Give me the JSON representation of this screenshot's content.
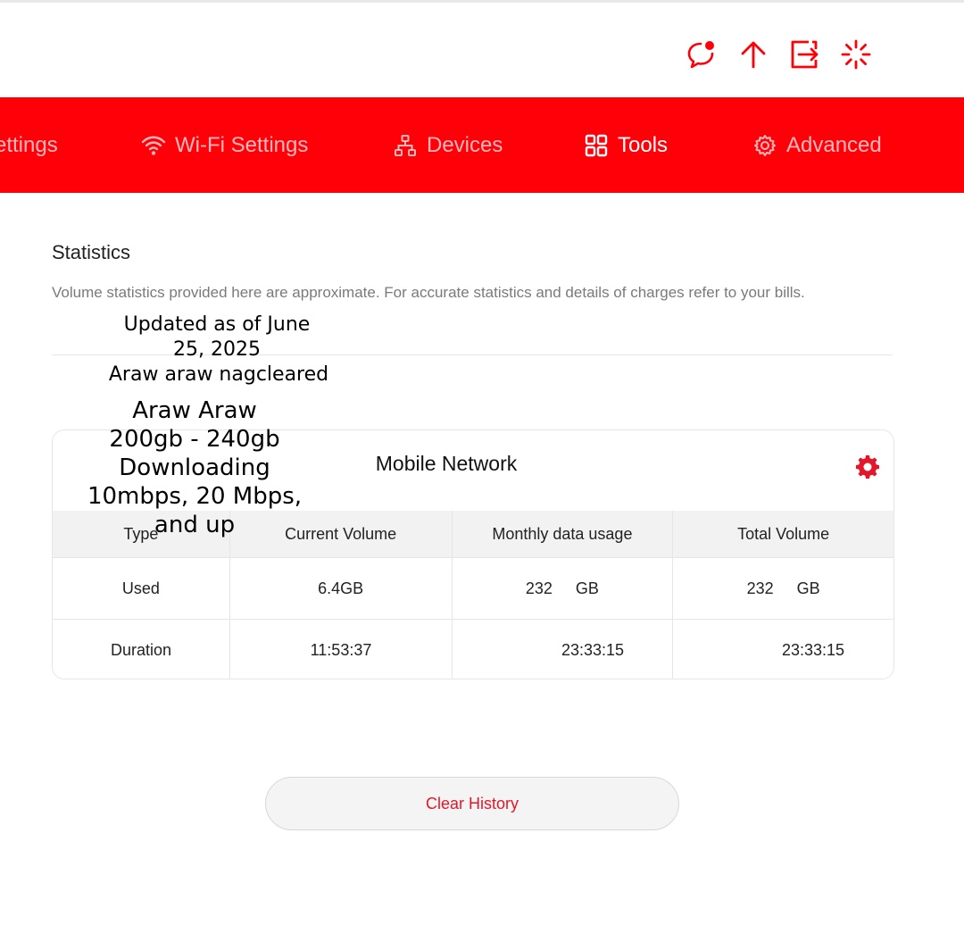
{
  "header": {
    "icons": [
      "message-alert-icon",
      "upload-icon",
      "logout-icon",
      "loading-spinner-icon"
    ],
    "accent_color": "#ff0009"
  },
  "nav": {
    "items": [
      {
        "label": "ettings",
        "icon": ""
      },
      {
        "label": "Wi-Fi Settings",
        "icon": "wifi-icon"
      },
      {
        "label": "Devices",
        "icon": "network-icon"
      },
      {
        "label": "Tools",
        "icon": "grid-icon",
        "active": true
      },
      {
        "label": "Advanced",
        "icon": "gear-icon"
      }
    ]
  },
  "page": {
    "title": "Statistics",
    "description": "Volume statistics provided here are approximate. For accurate statistics and details of charges refer to your bills."
  },
  "overlay": {
    "line1": "Updated as of June",
    "line2": "25, 2025",
    "line3": "Araw araw nagcleared",
    "line4": "Araw Araw",
    "line5": "200gb - 240gb",
    "line6": "Downloading",
    "line7": "10mbps, 20 Mbps,",
    "line8": "and up"
  },
  "card": {
    "title": "Mobile Network",
    "columns": [
      "Type",
      "Current Volume",
      "Monthly data usage",
      "Total Volume"
    ],
    "rows": [
      {
        "type": "Used",
        "current": "6.4GB",
        "monthly_num": "232",
        "monthly_unit": "GB",
        "total_num": "232",
        "total_unit": "GB"
      },
      {
        "type": "Duration",
        "current": "11:53:37",
        "monthly": "23:33:15",
        "total": "23:33:15"
      }
    ]
  },
  "actions": {
    "clear_history": "Clear History"
  }
}
